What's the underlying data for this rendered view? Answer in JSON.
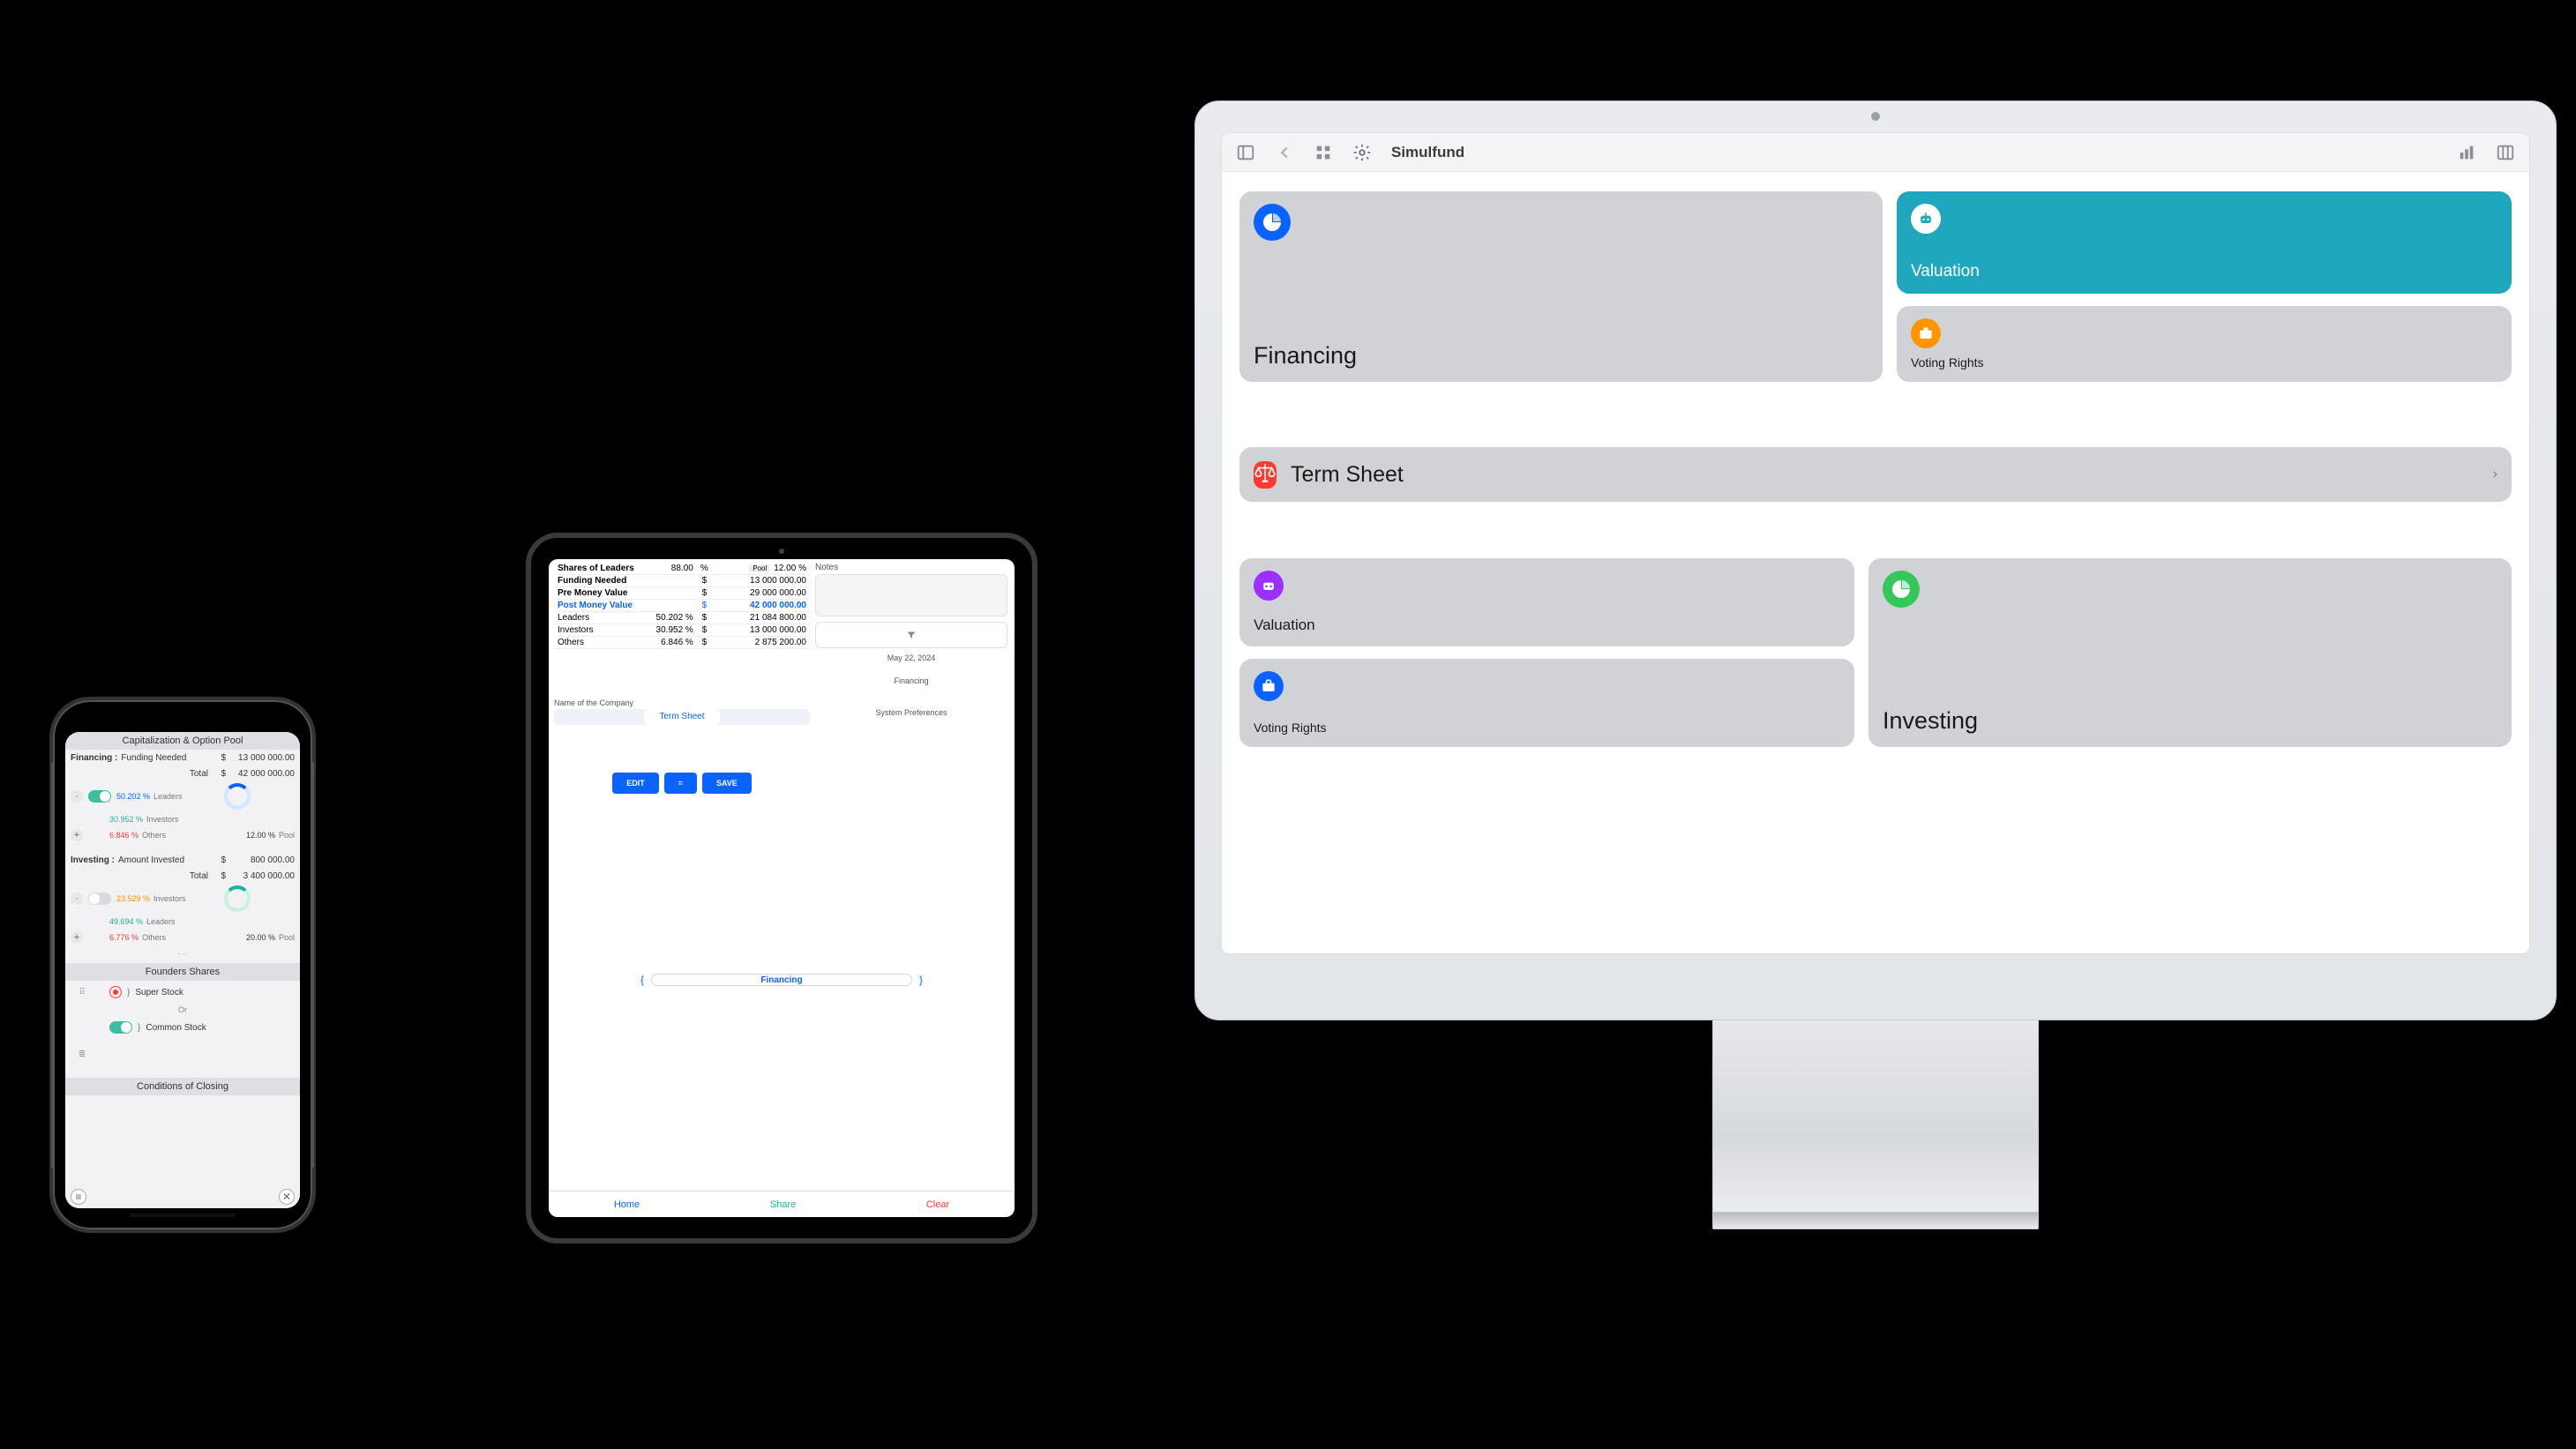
{
  "mac": {
    "app_title": "Simulfund",
    "toolbar_icons": {
      "sidebar": "sidebar-icon",
      "back": "chevron-left-icon",
      "grid": "grid-icon",
      "settings": "gear-icon",
      "chart": "chart-icon",
      "columns": "columns-icon"
    },
    "cards": {
      "financing": "Financing",
      "valuation_top": "Valuation",
      "voting_rights_top": "Voting Rights",
      "term_sheet": "Term Sheet",
      "valuation_left": "Valuation",
      "voting_rights_left": "Voting Rights",
      "investing": "Investing"
    },
    "icon_colors": {
      "financing": "#0a63ff",
      "valuation_top": "#ffffff",
      "voting_rights_top": "#ff9500",
      "term_sheet": "#ff3b30",
      "valuation_left": "#9b30ff",
      "voting_rights_left": "#0a63ff",
      "investing": "#34c759"
    }
  },
  "ipad": {
    "rows": {
      "shares_of_leaders": {
        "label": "Shares of Leaders",
        "num": "88.00",
        "unit": "%",
        "tag": "Pool",
        "tagnum": "12.00",
        "tagunit": "%"
      },
      "funding_needed": {
        "label": "Funding Needed",
        "cur": "$",
        "value": "13 000 000.00"
      },
      "pre_money": {
        "label": "Pre Money Value",
        "cur": "$",
        "value": "29 000 000.00"
      },
      "post_money": {
        "label": "Post Money Value",
        "cur": "$",
        "value": "42 000 000.00"
      },
      "leaders": {
        "label": "Leaders",
        "num": "50.202",
        "unit": "%",
        "cur": "$",
        "value": "21 084 800.00"
      },
      "investors": {
        "label": "Investors",
        "num": "30.952",
        "unit": "%",
        "cur": "$",
        "value": "13 000 000.00"
      },
      "others": {
        "label": "Others",
        "num": "6.846",
        "unit": "%",
        "cur": "$",
        "value": "2 875 200.00"
      }
    },
    "notes_label": "Notes",
    "filter_icon": "filter-icon",
    "date": "May 22, 2024",
    "sub1": "Financing",
    "sub2": "System Preferences",
    "name_label": "Name of the Company",
    "segment_active": "Term Sheet",
    "buttons": {
      "edit": "EDIT",
      "equal": "=",
      "save": "SAVE"
    },
    "slider": {
      "left": "{",
      "label": "Financing",
      "right": "}"
    },
    "tabs": {
      "home": "Home",
      "share": "Share",
      "clear": "Clear"
    }
  },
  "phone": {
    "section1": "Capitalization & Option Pool",
    "financing": {
      "title": "Financing :",
      "funding_needed_label": "Funding  Needed",
      "funding_needed_cur": "$",
      "funding_needed_value": "13 000 000.00",
      "total_label": "Total",
      "total_cur": "$",
      "total_value": "42 000 000.00",
      "leaders_pct": "50.202 %",
      "leaders_label": "Leaders",
      "investors_pct": "30.952 %",
      "investors_label": "Investors",
      "others_pct": "6.846 %",
      "others_label": "Others",
      "pool_pct": "12.00 %",
      "pool_label": "Pool"
    },
    "investing": {
      "title": "Investing :",
      "amount_label": "Amount  Invested",
      "amount_cur": "$",
      "amount_value": "800 000.00",
      "total_label": "Total",
      "total_cur": "$",
      "total_value": "3 400 000.00",
      "investors_pct": "23.529 %",
      "investors_label": "Investors",
      "leaders_pct": "49.694 %",
      "leaders_label": "Leaders",
      "others_pct": "6.776 %",
      "others_label": "Others",
      "pool_pct": "20.00 %",
      "pool_label": "Pool"
    },
    "section2": "Founders Shares",
    "super_stock": {
      "num": "}",
      "label": "Super Stock",
      "or": "Or"
    },
    "common_stock": {
      "num": "}",
      "label": "Common Stock"
    },
    "section3": "Conditions of Closing",
    "bottom": {
      "left": "≡",
      "right": "✕"
    }
  }
}
